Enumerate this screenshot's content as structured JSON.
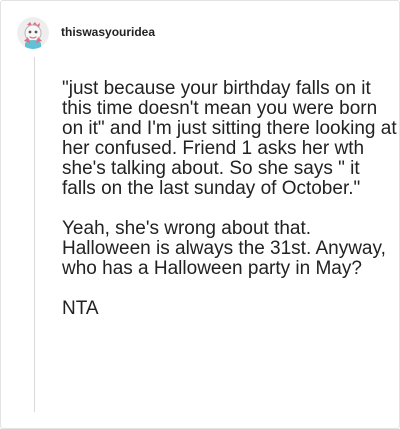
{
  "post": {
    "username": "thiswasyouridea",
    "paragraphs": [
      "\"just because your birthday falls on it this time doesn't mean you were born on it\" and I'm just sitting there looking at her confused. Friend 1 asks her wth she's talking about. So she says \" it falls on the last sunday of October.\"",
      "Yeah, she's wrong about that. Halloween is always the 31st. Anyway, who has a Halloween party in May?",
      "NTA"
    ]
  },
  "icons": {
    "avatar": "character-avatar"
  },
  "colors": {
    "text": "#222222",
    "border": "#e3e3e3",
    "thread_line": "#d9d9d9",
    "avatar_background": "#eeeeee",
    "avatar_accent": "#e16f86"
  }
}
